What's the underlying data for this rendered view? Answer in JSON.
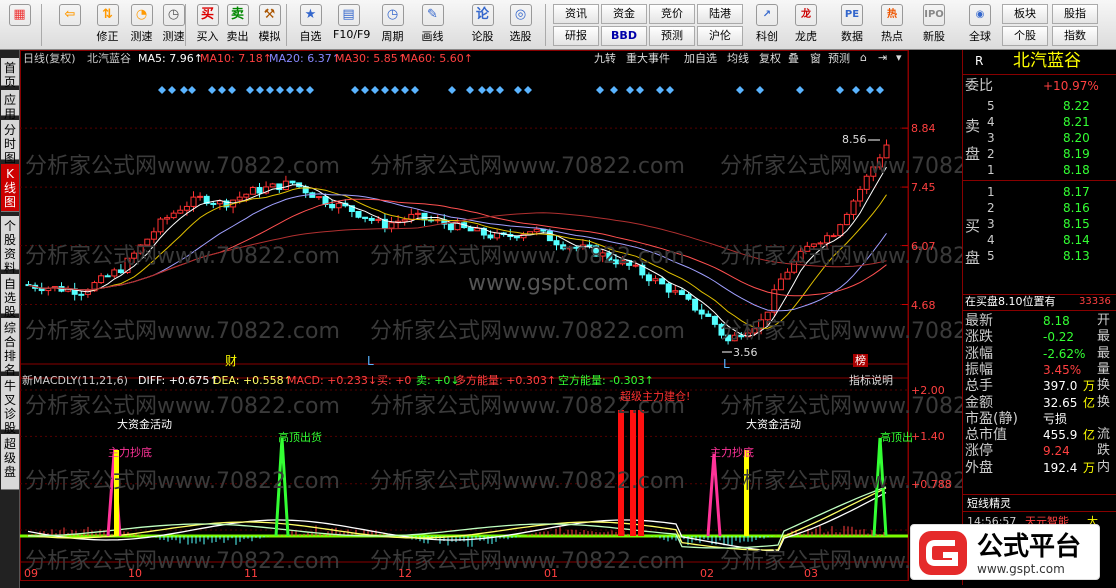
{
  "toolbar": {
    "items": [
      {
        "label": "",
        "icon": "grid-icon"
      },
      {
        "label": "",
        "icon": "back-arrow-icon"
      },
      {
        "label": "修正",
        "icon": "up-down-icon"
      },
      {
        "label": "测速",
        "icon": "speedometer-icon"
      },
      {
        "label": "测速",
        "icon": "clock-icon"
      },
      {
        "label": "买入",
        "icon": "buy-icon"
      },
      {
        "label": "卖出",
        "icon": "sell-icon"
      },
      {
        "label": "模拟",
        "icon": "hammer-icon"
      },
      {
        "label": "自选",
        "icon": "star-icon"
      },
      {
        "label": "F10/F9",
        "icon": "f10-icon"
      },
      {
        "label": "周期",
        "icon": "period-icon"
      },
      {
        "label": "画线",
        "icon": "pencil-icon"
      },
      {
        "label": "论股",
        "icon": "discuss-icon"
      },
      {
        "label": "选股",
        "icon": "select-stock-icon"
      }
    ],
    "btn_rows": [
      [
        "资讯",
        "资金",
        "竞价",
        "陆港"
      ],
      [
        "研报",
        "BBD",
        "预测",
        "沪伦"
      ]
    ],
    "items2": [
      {
        "label": "科创",
        "icon": "kechuang-icon"
      },
      {
        "label": "龙虎",
        "icon": "dragon-tiger-icon"
      },
      {
        "label": "数据",
        "icon": "pe-data-icon"
      },
      {
        "label": "热点",
        "icon": "hot-icon"
      },
      {
        "label": "新股",
        "icon": "ipo-icon"
      },
      {
        "label": "全球",
        "icon": "globe-icon"
      }
    ],
    "right_btns": [
      [
        "板块",
        "股指"
      ],
      [
        "个股",
        "指数"
      ]
    ]
  },
  "left_tabs": [
    "首页",
    "应用",
    "分时图",
    "K线图",
    "个股资料",
    "自选股",
    "综合排名",
    "牛叉诊股",
    "超级盘"
  ],
  "chart": {
    "header": {
      "title": "日线(复权)",
      "stock": "北汽蓝谷",
      "ma5": "MA5: 7.96↑",
      "ma10": "MA10: 7.18↑",
      "ma20": "MA20: 6.37↑",
      "ma30": "MA30: 5.85↑",
      "ma60": "MA60: 5.60↑"
    },
    "tools": [
      "九转",
      "重大事件",
      "加自选",
      "均线",
      "复权",
      "叠",
      "窗",
      "预测"
    ],
    "watermark": "分析家公式网www.70822.com",
    "watermark2": "www.gspt.com",
    "price_labels": [
      "8.84",
      "7.45",
      "6.07",
      "4.68"
    ],
    "price_levels": [
      8.84,
      7.45,
      6.07,
      4.68
    ],
    "high_label": "8.56",
    "low_label": "3.56",
    "high_value": 8.56,
    "low_value": 3.56,
    "marks": {
      "cai": "财",
      "l1": "L",
      "l2": "L",
      "bang": "榜"
    },
    "macd_header": {
      "name": "新MACDLY(11,21,6)",
      "diff": "DIFF: +0.675↑",
      "dea": "DEA: +0.558↑",
      "macd": "MACD: +0.233↓",
      "buy": "买: +0",
      "sell": "卖: +0↓",
      "duo": "多方能量: +0.303↑",
      "kong": "空方能量: -0.303↑"
    },
    "indicator_btn": "指标说明",
    "macd_labels": [
      "+2.00",
      "+1.40",
      "+0.788",
      "+0.189"
    ],
    "annotations": {
      "big_money1": "大资金活动",
      "bottom1": "主力抄底",
      "top1": "高顶出货",
      "super": "超级主力建仓!",
      "big_money2": "大资金活动",
      "bottom2": "主力抄底",
      "top2": "高顶出"
    },
    "months": [
      "09",
      "10",
      "11",
      "12",
      "01",
      "02",
      "03"
    ]
  },
  "chart_data": {
    "type": "candlestick",
    "title": "北汽蓝谷",
    "period": "日线(复权)",
    "x": [
      "09",
      "10",
      "11",
      "12",
      "01",
      "02",
      "03"
    ],
    "ma": {
      "MA5": 7.96,
      "MA10": 7.18,
      "MA20": 6.37,
      "MA30": 5.85,
      "MA60": 5.6
    },
    "ylim": [
      3.56,
      8.84
    ],
    "high": 8.56,
    "low": 3.56,
    "macd": {
      "DIFF": 0.675,
      "DEA": 0.558,
      "MACD": 0.233,
      "buy": 0,
      "sell": 0,
      "duo": 0.303,
      "kong": -0.303,
      "ylim": [
        0.189,
        2.0
      ]
    }
  },
  "info": {
    "head_r": "R",
    "name": "北汽蓝谷",
    "weibi_label": "委比",
    "weibi": "+10.97%",
    "sell": [
      {
        "n": "5",
        "p": "8.22"
      },
      {
        "n": "4",
        "p": "8.21"
      },
      {
        "n": "3",
        "p": "8.20"
      },
      {
        "n": "2",
        "p": "8.19"
      },
      {
        "n": "1",
        "p": "8.18"
      }
    ],
    "buy": [
      {
        "n": "1",
        "p": "8.17"
      },
      {
        "n": "2",
        "p": "8.16"
      },
      {
        "n": "3",
        "p": "8.15"
      },
      {
        "n": "4",
        "p": "8.14"
      },
      {
        "n": "5",
        "p": "8.13"
      }
    ],
    "sell_label": [
      "卖",
      "盘"
    ],
    "buy_label": [
      "买",
      "盘"
    ],
    "position": "在买盘8.10位置有",
    "position_val": "33336",
    "stats": [
      {
        "k": "最新",
        "v": "8.18",
        "x": "开"
      },
      {
        "k": "涨跌",
        "v": "-0.22",
        "x": "最"
      },
      {
        "k": "涨幅",
        "v": "-2.62%",
        "x": "最"
      },
      {
        "k": "振幅",
        "v": "3.45%",
        "x": "量"
      },
      {
        "k": "总手",
        "v": "397.0",
        "u": "万",
        "x": "换"
      },
      {
        "k": "金额",
        "v": "32.65",
        "u": "亿",
        "x": "换"
      },
      {
        "k": "市盈(静)",
        "v": "亏损",
        "x": ""
      },
      {
        "k": "总市值",
        "v": "455.9",
        "u": "亿",
        "x": "流"
      },
      {
        "k": "涨停",
        "v": "9.24",
        "x": "跌"
      },
      {
        "k": "外盘",
        "v": "192.4",
        "u": "万",
        "x": "内"
      }
    ],
    "section": "短线精灵",
    "time": "14:56:57",
    "news": "天元智能",
    "news2": "大"
  },
  "logo": {
    "main": "公式平台",
    "sub": "www.gspt.com"
  }
}
